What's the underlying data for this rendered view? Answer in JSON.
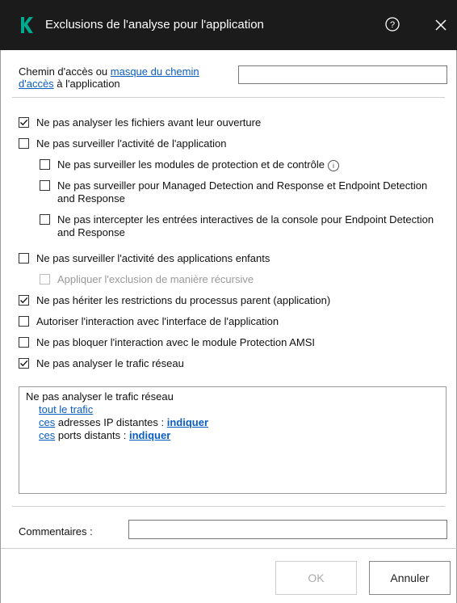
{
  "window": {
    "title": "Exclusions de l'analyse pour l'application",
    "logo_letter": "K",
    "accent_color": "#00a88e"
  },
  "path": {
    "label_prefix": "Chemin d'accès ou ",
    "link": "masque du chemin d'accès",
    "label_suffix": " à l'application",
    "value": ""
  },
  "options": [
    {
      "label": "Ne pas analyser les fichiers avant leur ouverture",
      "checked": true
    },
    {
      "label": "Ne pas surveiller l'activité de l'application",
      "checked": false
    },
    {
      "label": "Ne pas surveiller les modules de protection et de contrôle",
      "checked": false
    },
    {
      "label": "Ne pas surveiller pour Managed Detection and Response et Endpoint Detection and Response",
      "checked": false
    },
    {
      "label": "Ne pas intercepter les entrées interactives de la console pour Endpoint Detection and Response",
      "checked": false
    },
    {
      "label": "Ne pas surveiller l'activité des applications enfants",
      "checked": false
    },
    {
      "label": "Appliquer l'exclusion de manière récursive",
      "checked": false,
      "disabled": true
    },
    {
      "label": "Ne pas hériter les restrictions du processus parent (application)",
      "checked": true
    },
    {
      "label": "Autoriser l'interaction avec l'interface de l'application",
      "checked": false
    },
    {
      "label": "Ne pas bloquer l'interaction avec le module Protection AMSI",
      "checked": false
    },
    {
      "label": "Ne pas analyser le trafic réseau",
      "checked": true
    }
  ],
  "traffic": {
    "heading": "Ne pas analyser le trafic réseau",
    "all_traffic": "tout le trafic",
    "ip_link": "ces",
    "ip_text": " adresses IP distantes : ",
    "ip_action": "indiquer",
    "ports_link": "ces",
    "ports_text": " ports distants : ",
    "ports_action": "indiquer"
  },
  "comment": {
    "label": "Commentaires :",
    "value": ""
  },
  "buttons": {
    "ok": "OK",
    "cancel": "Annuler"
  }
}
